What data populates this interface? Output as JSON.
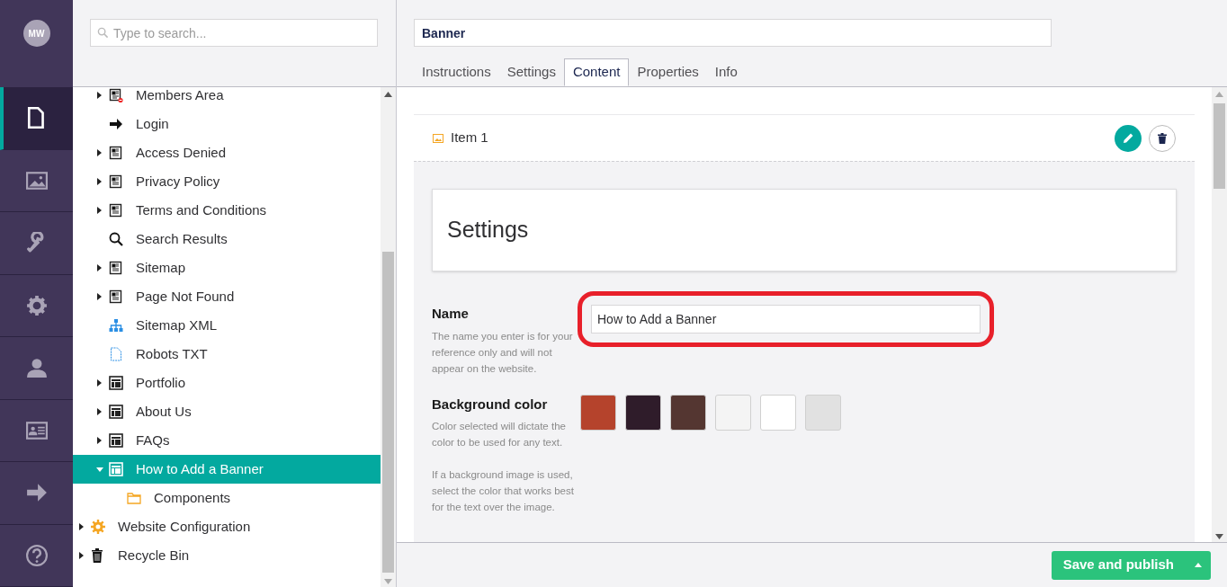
{
  "rail": {
    "avatar": "MW",
    "items": [
      {
        "kind": "content",
        "selected": true
      },
      {
        "kind": "media",
        "selected": false
      },
      {
        "kind": "settings",
        "selected": false
      },
      {
        "kind": "config",
        "selected": false
      },
      {
        "kind": "members",
        "selected": false
      },
      {
        "kind": "forms",
        "selected": false
      },
      {
        "kind": "redirect",
        "selected": false
      },
      {
        "kind": "help",
        "selected": false
      }
    ]
  },
  "tree": {
    "search": {
      "placeholder": "Type to search..."
    },
    "root_children": [
      {
        "label": "Members Area",
        "kind": "protected-page",
        "has_children": true,
        "expanded": false,
        "selected": false
      },
      {
        "label": "Login",
        "kind": "arrow",
        "has_children": false,
        "selected": false
      },
      {
        "label": "Access Denied",
        "kind": "page",
        "has_children": true,
        "expanded": false,
        "selected": false
      },
      {
        "label": "Privacy Policy",
        "kind": "page",
        "has_children": true,
        "expanded": false,
        "selected": false
      },
      {
        "label": "Terms and Conditions",
        "kind": "page",
        "has_children": true,
        "expanded": false,
        "selected": false
      },
      {
        "label": "Search Results",
        "kind": "search",
        "has_children": false,
        "selected": false
      },
      {
        "label": "Sitemap",
        "kind": "page",
        "has_children": true,
        "expanded": false,
        "selected": false
      },
      {
        "label": "Page Not Found",
        "kind": "page",
        "has_children": true,
        "expanded": false,
        "selected": false
      },
      {
        "label": "Sitemap XML",
        "kind": "sitemap",
        "has_children": false,
        "selected": false
      },
      {
        "label": "Robots TXT",
        "kind": "file",
        "has_children": false,
        "selected": false
      },
      {
        "label": "Portfolio",
        "kind": "layout",
        "has_children": true,
        "expanded": false,
        "selected": false
      },
      {
        "label": "About Us",
        "kind": "layout",
        "has_children": true,
        "expanded": false,
        "selected": false
      },
      {
        "label": "FAQs",
        "kind": "layout",
        "has_children": true,
        "expanded": false,
        "selected": false
      },
      {
        "label": "How to Add a Banner",
        "kind": "layout",
        "has_children": true,
        "expanded": true,
        "selected": true,
        "children": [
          {
            "label": "Components",
            "kind": "folder",
            "has_children": false,
            "selected": false
          }
        ]
      }
    ],
    "roots": [
      {
        "label": "Website Configuration",
        "kind": "gear",
        "has_children": true,
        "expanded": false,
        "selected": false
      },
      {
        "label": "Recycle Bin",
        "kind": "trash",
        "has_children": true,
        "expanded": false,
        "selected": false
      }
    ]
  },
  "editor": {
    "name_value": "Banner",
    "tabs": [
      {
        "label": "Instructions",
        "selected": false
      },
      {
        "label": "Settings",
        "selected": false
      },
      {
        "label": "Content",
        "selected": true
      },
      {
        "label": "Properties",
        "selected": false
      },
      {
        "label": "Info",
        "selected": false
      }
    ],
    "item": {
      "label": "Item 1"
    },
    "section_title": "Settings",
    "fields": [
      {
        "kind": "text",
        "label": "Name",
        "help": [
          "The name you enter is for your reference only and will not appear on the website."
        ],
        "value": "How to Add a Banner",
        "highlighted": true
      },
      {
        "kind": "swatches",
        "label": "Background color",
        "help": [
          "Color selected will dictate the color to be used for any text.",
          "If a background image is used, select the color that works best for the text over the image."
        ],
        "swatches": [
          {
            "color": "#b5432c"
          },
          {
            "color": "#2f1c2a"
          },
          {
            "color": "#543631"
          },
          {
            "color": "#f4f4f4"
          },
          {
            "color": "#ffffff"
          },
          {
            "color": "#e1e1e1"
          }
        ]
      }
    ]
  },
  "footer": {
    "button": "Save and publish"
  }
}
